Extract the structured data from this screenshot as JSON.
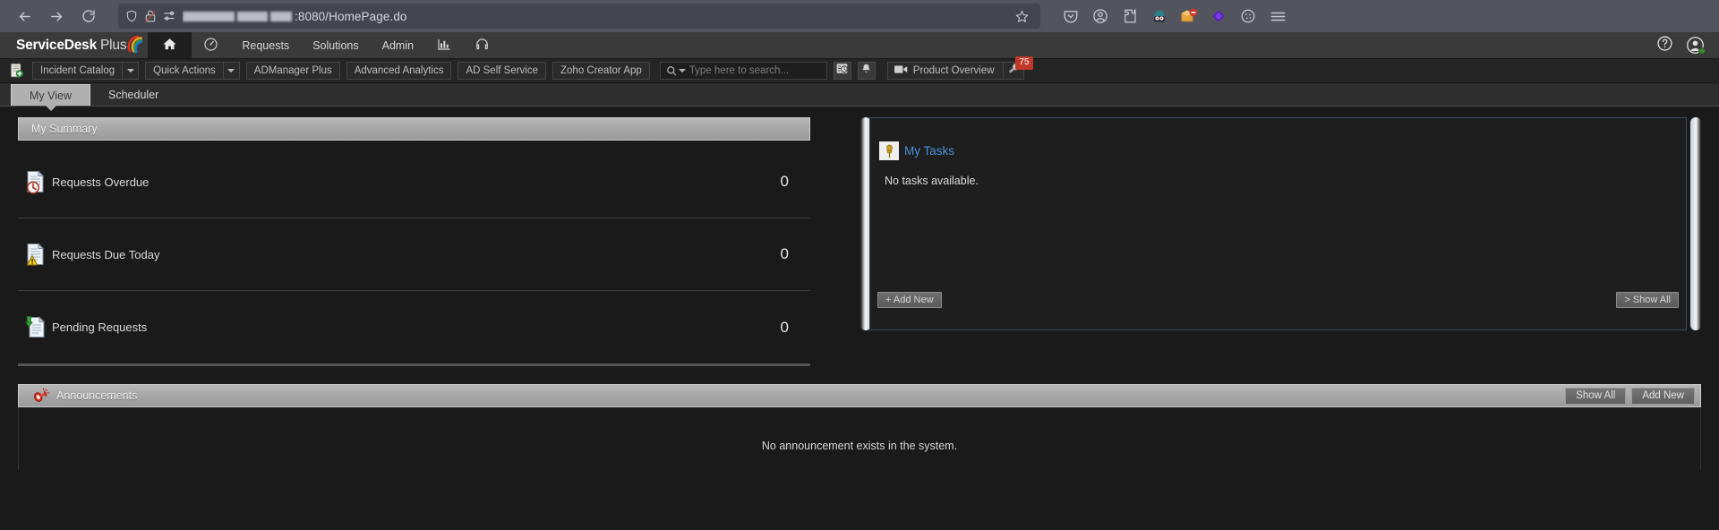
{
  "browser": {
    "back_icon": "arrow-left-icon",
    "forward_icon": "arrow-right-icon",
    "reload_icon": "reload-icon",
    "shield_icon": "shield-icon",
    "lock_broken_icon": "lock-broken-icon",
    "permissions_icon": "permissions-icon",
    "url_suffix": ":8080/HomePage.do",
    "bookmark_icon": "star-icon",
    "extensions": [
      {
        "name": "pocket-icon"
      },
      {
        "name": "account-icon"
      },
      {
        "name": "extension-puzzle-icon"
      },
      {
        "name": "avatar-extension-icon"
      },
      {
        "name": "blocked-extension-icon"
      },
      {
        "name": "diamond-extension-icon"
      },
      {
        "name": "cookie-extension-icon"
      },
      {
        "name": "hamburger-menu-icon"
      }
    ]
  },
  "app_header": {
    "brand_primary": "ServiceDesk",
    "brand_secondary": "Plus",
    "nav": [
      {
        "label": "",
        "icon": "home-icon",
        "active": true
      },
      {
        "label": "",
        "icon": "dashboard-gauge-icon",
        "active": false
      },
      {
        "label": "Requests",
        "icon": "",
        "active": false
      },
      {
        "label": "Solutions",
        "icon": "",
        "active": false
      },
      {
        "label": "Admin",
        "icon": "",
        "active": false
      },
      {
        "label": "",
        "icon": "bar-chart-icon",
        "active": false
      },
      {
        "label": "",
        "icon": "headset-icon",
        "active": false
      }
    ],
    "help_icon": "help-question-icon",
    "user_icon": "user-avatar-icon",
    "user_status_color": "#3a8a2e"
  },
  "toolbar": {
    "catalog_icon": "incident-catalog-icon",
    "incident_catalog": "Incident Catalog",
    "quick_actions": "Quick Actions",
    "admanager_plus": "ADManager Plus",
    "advanced_analytics": "Advanced Analytics",
    "ad_self_service": "AD Self Service",
    "zoho_creator_app": "Zoho Creator App",
    "search_icon": "search-icon",
    "search_placeholder": "Type here to search...",
    "search_value": "",
    "reminders_icon": "reminders-clock-icon",
    "notifications_icon": "bell-icon",
    "product_overview": "Product Overview",
    "product_overview_icon": "video-camera-icon",
    "announce_icon": "megaphone-icon",
    "announce_badge": "75",
    "badge_color": "#c0392b"
  },
  "tabs": [
    {
      "label": "My View",
      "active": true
    },
    {
      "label": "Scheduler",
      "active": false
    }
  ],
  "my_summary": {
    "title": "My Summary",
    "rows": [
      {
        "label": "Requests Overdue",
        "value": "0",
        "icon": "document-overdue-icon"
      },
      {
        "label": "Requests Due Today",
        "value": "0",
        "icon": "document-warning-icon"
      },
      {
        "label": "Pending Requests",
        "value": "0",
        "icon": "document-pending-icon"
      }
    ]
  },
  "my_tasks": {
    "title": "My Tasks",
    "icon": "pushpin-icon",
    "empty_message": "No tasks available.",
    "add_new": "+ Add New",
    "show_all": "> Show All",
    "title_color": "#4a90d9"
  },
  "announcements": {
    "title": "Announcements",
    "icon": "megaphone-red-icon",
    "show_all": "Show All",
    "add_new": "Add New",
    "empty_message": "No announcement exists in the system."
  }
}
